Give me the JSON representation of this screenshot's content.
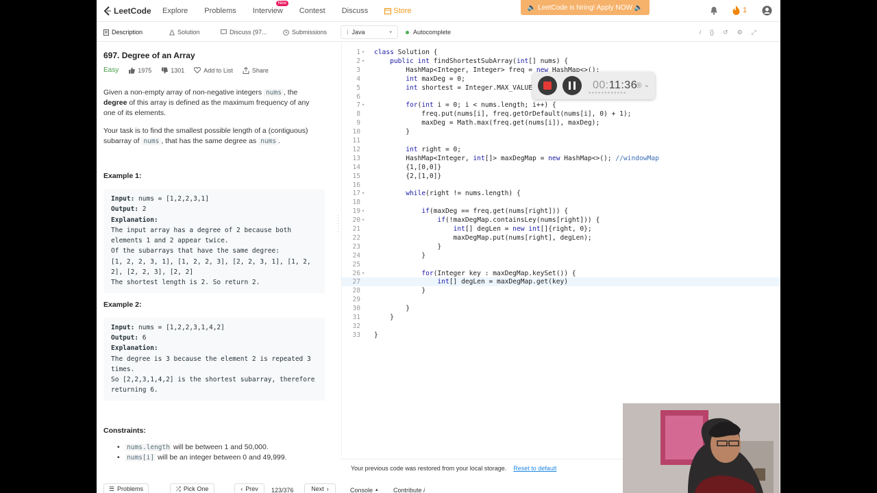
{
  "nav": {
    "logo": "LeetCode",
    "items": [
      "Explore",
      "Problems",
      "Interview",
      "Contest",
      "Discuss"
    ],
    "new_badge": "New",
    "store": "Store",
    "hiring_banner": "🔈 LeetCode is hiring! Apply NOW 🔈",
    "streak": "1"
  },
  "tabs": {
    "description": "Description",
    "solution": "Solution",
    "discuss": "Discuss (97...",
    "submissions": "Submissions",
    "language": "Java",
    "autocomplete": "Autocomplete"
  },
  "problem": {
    "title": "697. Degree of an Array",
    "difficulty": "Easy",
    "likes": "1975",
    "dislikes": "1301",
    "add_to_list": "Add to List",
    "share": "Share",
    "p1_a": "Given a non-empty array of non-negative integers ",
    "p1_code": "nums",
    "p1_b": ", the ",
    "p1_bold": "degree",
    "p1_c": " of this array is defined as the maximum frequency of any one of its elements.",
    "p2_a": "Your task is to find the smallest possible length of a (contiguous) subarray of ",
    "p2_code1": "nums",
    "p2_b": ", that has the same degree as ",
    "p2_code2": "nums",
    "p2_c": ".",
    "example1_title": "Example 1:",
    "example1": {
      "input_label": "Input:",
      "input": " nums = [1,2,2,3,1]",
      "output_label": "Output:",
      "output": " 2",
      "expl_label": "Explanation:",
      "expl": "The input array has a degree of 2 because both elements 1 and 2 appear twice.\nOf the subarrays that have the same degree:\n[1, 2, 2, 3, 1], [1, 2, 2, 3], [2, 2, 3, 1], [1, 2, 2], [2, 2, 3], [2, 2]\nThe shortest length is 2. So return 2."
    },
    "example2_title": "Example 2:",
    "example2": {
      "input_label": "Input:",
      "input": " nums = [1,2,2,3,1,4,2]",
      "output_label": "Output:",
      "output": " 6",
      "expl_label": "Explanation:",
      "expl": "The degree is 3 because the element 2 is repeated 3 times.\nSo [2,2,3,1,4,2] is the shortest subarray, therefore returning 6."
    },
    "constraints_title": "Constraints:",
    "c1_code": "nums.length",
    "c1_text": " will be between 1 and 50,000.",
    "c2_code": "nums[i]",
    "c2_text": " will be an integer between 0 and 49,999."
  },
  "code_lines": [
    "class Solution {",
    "    public int findShortestSubArray(int[] nums) {",
    "        HashMap<Integer, Integer> freq = new HashMap<>();",
    "        int maxDeg = 0;",
    "        int shortest = Integer.MAX_VALUE;",
    "",
    "        for(int i = 0; i < nums.length; i++) {",
    "            freq.put(nums[i], freq.getOrDefault(nums[i], 0) + 1);",
    "            maxDeg = Math.max(freq.get(nums[i]), maxDeg);",
    "        }",
    "",
    "        int right = 0;",
    "        HashMap<Integer, int[]> maxDegMap = new HashMap<>(); //windowMap",
    "        {1,[0,0]}",
    "        {2,[1,0]}",
    "",
    "        while(right != nums.length) {",
    "",
    "            if(maxDeg == freq.get(nums[right])) {",
    "                if(!maxDegMap.containsLey(nums[right])) {",
    "                    int[] degLen = new int[]{right, 0};",
    "                    maxDegMap.put(nums[right], degLen);",
    "                }",
    "            }",
    "",
    "            for(Integer key : maxDegMap.keySet()) {",
    "                int[] degLen = maxDegMap.get(key)",
    "            }",
    "",
    "        }",
    "    }",
    "",
    "}"
  ],
  "fold_lines": [
    1,
    2,
    7,
    17,
    19,
    20,
    26
  ],
  "active_line": 27,
  "restore": {
    "message": "Your previous code was restored from your local storage.",
    "reset_link": "Reset to default"
  },
  "bottom": {
    "problems": "Problems",
    "pick_one": "Pick One",
    "prev": "Prev",
    "page": "123/376",
    "next": "Next",
    "console": "Console",
    "contribute": "Contribute"
  },
  "recorder": {
    "time_dim": "00:",
    "time": "11:36"
  },
  "colors": {
    "accent_orange": "#f09a1a",
    "easy_green": "#43a047",
    "link_blue": "#1e88e5",
    "record_red": "#e53935"
  }
}
